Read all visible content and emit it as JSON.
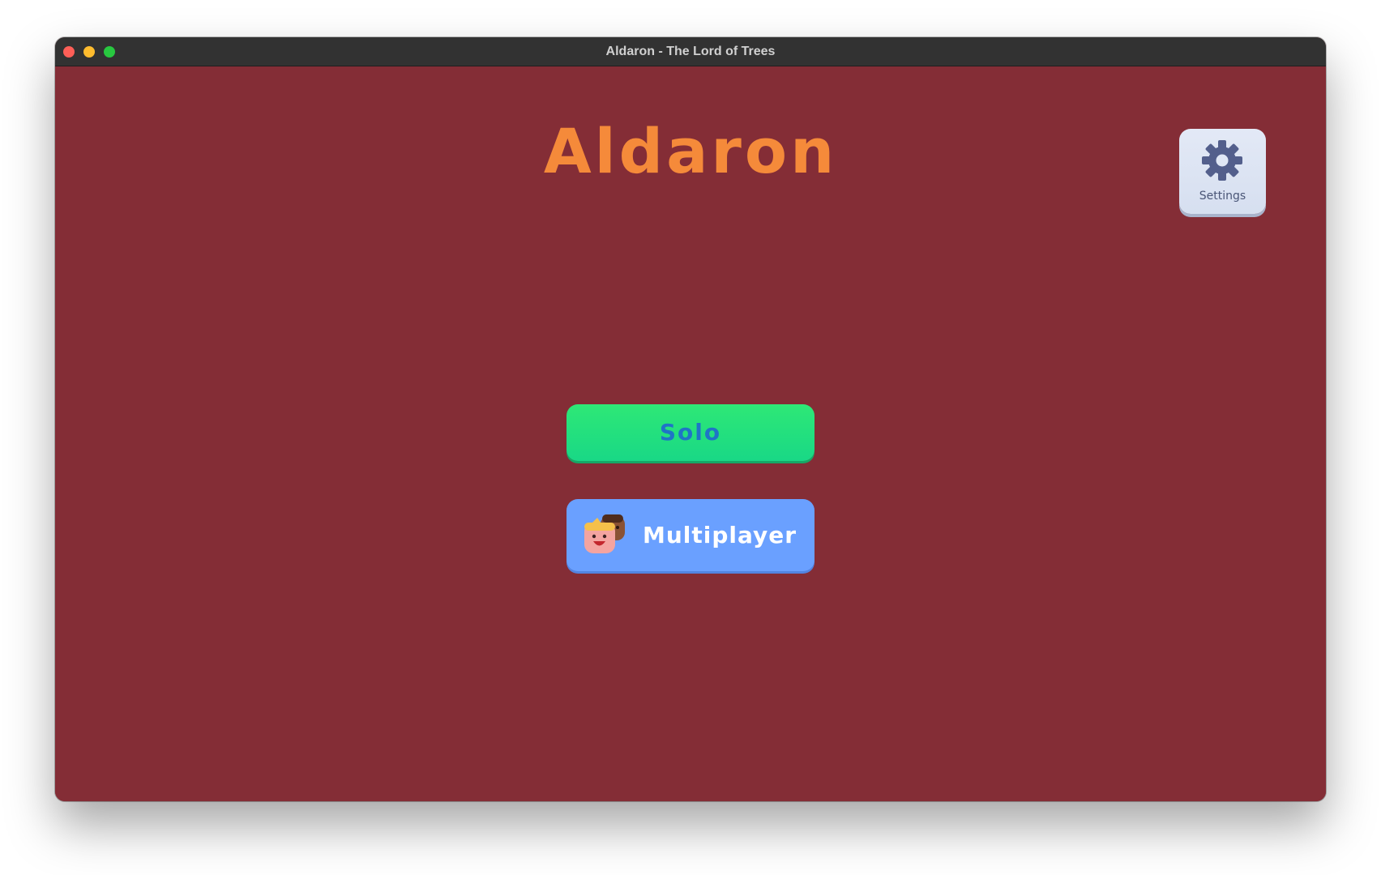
{
  "window": {
    "title": "Aldaron - The Lord of Trees"
  },
  "app": {
    "title": "Aldaron"
  },
  "settings": {
    "label": "Settings",
    "icon": "gear-icon"
  },
  "menu": {
    "solo_label": "Solo",
    "multiplayer_label": "Multiplayer",
    "multiplayer_icon": "players-icon"
  },
  "colors": {
    "background": "#842d36",
    "title": "#f58a3a",
    "solo_button": "#2ee876",
    "solo_text": "#1f74c7",
    "multiplayer_button": "#6aa0ff",
    "settings_button": "#e3e9f6"
  }
}
